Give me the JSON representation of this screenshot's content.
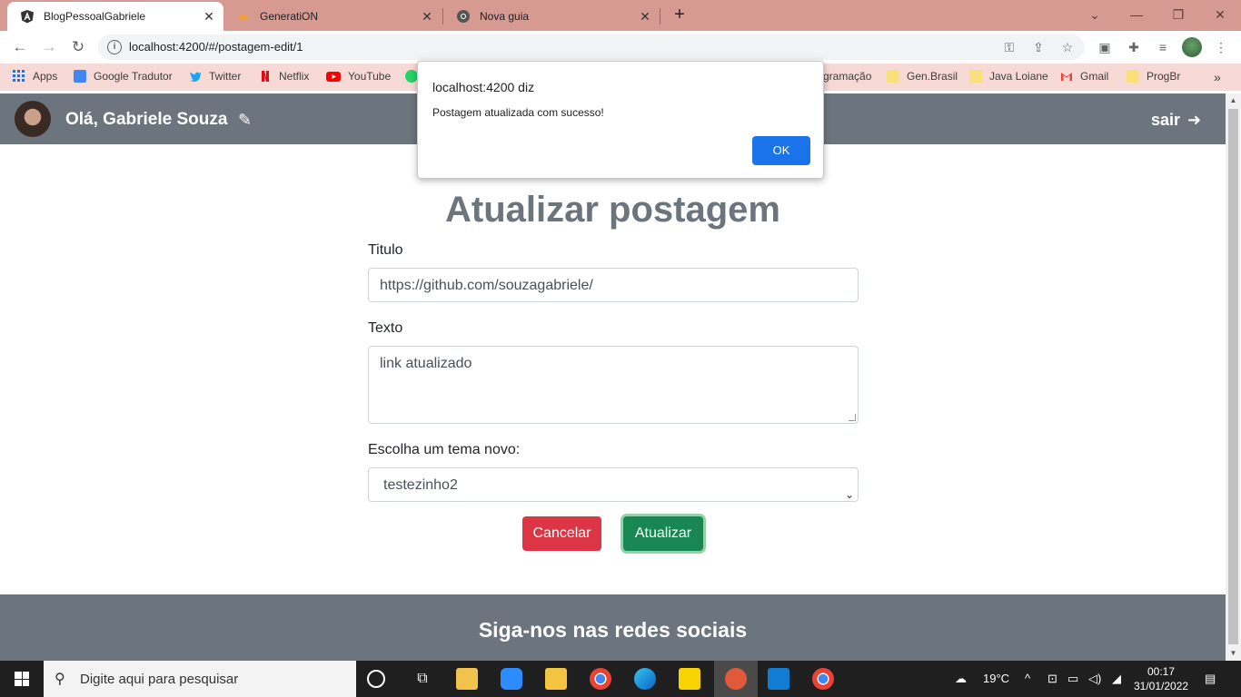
{
  "browser": {
    "tabs": [
      {
        "label": "BlogPessoalGabriele",
        "active": true
      },
      {
        "label": "GeneratiON",
        "active": false
      },
      {
        "label": "Nova guia",
        "active": false
      }
    ],
    "url": "localhost:4200/#/postagem-edit/1"
  },
  "bookmarks": [
    {
      "label": "Apps"
    },
    {
      "label": "Google Tradutor"
    },
    {
      "label": "Twitter"
    },
    {
      "label": "Netflix"
    },
    {
      "label": "YouTube"
    },
    {
      "label": "gramação"
    },
    {
      "label": "Gen.Brasil"
    },
    {
      "label": "Java Loiane"
    },
    {
      "label": "Gmail"
    },
    {
      "label": "ProgBr"
    }
  ],
  "header": {
    "greeting": "Olá, Gabriele Souza",
    "logout": "sair"
  },
  "form": {
    "title": "Atualizar postagem",
    "titulo_label": "Titulo",
    "titulo_value": "https://github.com/souzagabriele/",
    "texto_label": "Texto",
    "texto_value": "link atualizado",
    "tema_label": "Escolha um tema novo:",
    "tema_value": "testezinho2",
    "cancel": "Cancelar",
    "submit": "Atualizar"
  },
  "footer": {
    "title": "Siga-nos nas redes sociais"
  },
  "dialog": {
    "title": "localhost:4200 diz",
    "message": "Postagem atualizada com sucesso!",
    "ok": "OK"
  },
  "taskbar": {
    "search_placeholder": "Digite aqui para pesquisar",
    "weather": "19°C",
    "time": "00:17",
    "date": "31/01/2022"
  },
  "colors": {
    "nav": "#6c757d",
    "danger": "#dc3545",
    "success": "#198754",
    "dialog_button": "#1a73e8",
    "tabstrip": "#d69a93"
  }
}
